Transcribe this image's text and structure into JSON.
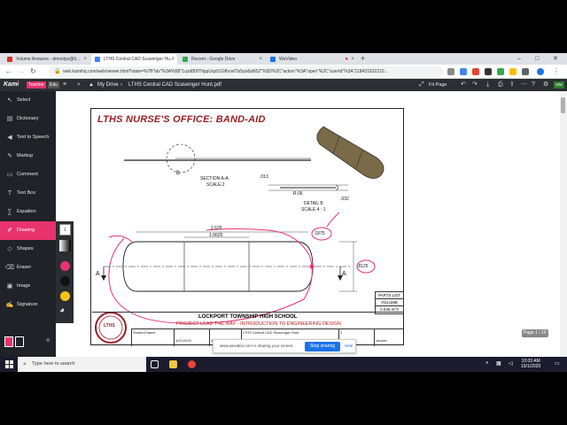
{
  "browser": {
    "tabs": [
      {
        "label": "Volume Answers - dmostyo@lt...",
        "favicon_color": "#d93025",
        "active": false
      },
      {
        "label": "LTHS Central CAD Scavenger Hu...",
        "favicon_color": "#3b82f6",
        "active": true
      },
      {
        "label": "Recent - Google Drive",
        "favicon_color": "#34a853",
        "active": false
      },
      {
        "label": "WeVideo",
        "favicon_color": "#1a73e8",
        "active": false
      }
    ],
    "url": "web.kamihq.com/web/viewer.html?state=%7B\"ids\"%3A%5B\"1uzd80tTNppUqs51Gfhce6Ta5ps8aN5Z\"%5D%2C\"action\"%3A\"open\"%2C\"userId\"%3A\"118431632210..."
  },
  "kami": {
    "logo": "Kami",
    "badge_teacher": "Teacher",
    "badge_edu": "Edu",
    "breadcrumb_root": "My Drive",
    "breadcrumb_sep": "›",
    "file_name": "LTHS Central CAD Scavenger Hunt.pdf",
    "fit_page": "Fit Page"
  },
  "tools": [
    {
      "label": "Select",
      "icon": "cursor-icon",
      "glyph": "↖"
    },
    {
      "label": "Dictionary",
      "icon": "book-icon",
      "glyph": "▤"
    },
    {
      "label": "Text to Speech",
      "icon": "speaker-icon",
      "glyph": "◀"
    },
    {
      "label": "Markup",
      "icon": "highlighter-icon",
      "glyph": "✎"
    },
    {
      "label": "Comment",
      "icon": "comment-icon",
      "glyph": "▭"
    },
    {
      "label": "Text Box",
      "icon": "textbox-icon",
      "glyph": "T"
    },
    {
      "label": "Equation",
      "icon": "equation-icon",
      "glyph": "∑"
    },
    {
      "label": "Drawing",
      "icon": "pencil-icon",
      "glyph": "✐"
    },
    {
      "label": "Shapes",
      "icon": "shapes-icon",
      "glyph": "◇"
    },
    {
      "label": "Eraser",
      "icon": "eraser-icon",
      "glyph": "⌫"
    },
    {
      "label": "Image",
      "icon": "image-icon",
      "glyph": "▣"
    },
    {
      "label": "Signature",
      "icon": "signature-icon",
      "glyph": "✍"
    }
  ],
  "drawing_colors": [
    "#e8336f",
    "#111111",
    "#f5c518"
  ],
  "drawing_size": "1",
  "document": {
    "title": "LTHS NURSE'S OFFICE:  BAND-AID",
    "section_label": "SECTION A-A",
    "section_scale": "SCALE 2",
    "section_letter": "B",
    "dim_013": ".013",
    "dim_r06": "R.06",
    "dim_032": ".032",
    "detail_label": "DETAIL  B",
    "detail_scale": "SCALE 4 : 1",
    "dim_2625": "2.625",
    "dim_10625": "1.0625",
    "dim_1875": ".1875",
    "dim_8125": ".8125",
    "arrow_a_left": "A",
    "arrow_a_right": "A",
    "parts_list": "PARTS LIST",
    "volume_label": "VOLUME",
    "volume_value": "0.046 in^3",
    "school": "LOCKPORT TOWNSHIP HIGH SCHOOL",
    "course": "PROJECT LEAD THE WAY - INTRODUCTION TO ENGINEERING DESIGN",
    "tb_student": "Student Name",
    "tb_date": "10/1/2020",
    "tb_one": "1",
    "tb_title": "LTHS Central CAD Scavenger Hunt",
    "tb_two": "2",
    "tb_initials": "cdozier",
    "logo_text": "LTHS"
  },
  "share_banner": {
    "text": "www.wevideo.com is sharing your screen.",
    "stop": "Stop sharing",
    "hide": "Hide"
  },
  "page_indicator": "Page  1  / 10",
  "taskbar": {
    "search_placeholder": "Type here to search",
    "time": "10:03 AM",
    "date": "10/1/2020"
  }
}
